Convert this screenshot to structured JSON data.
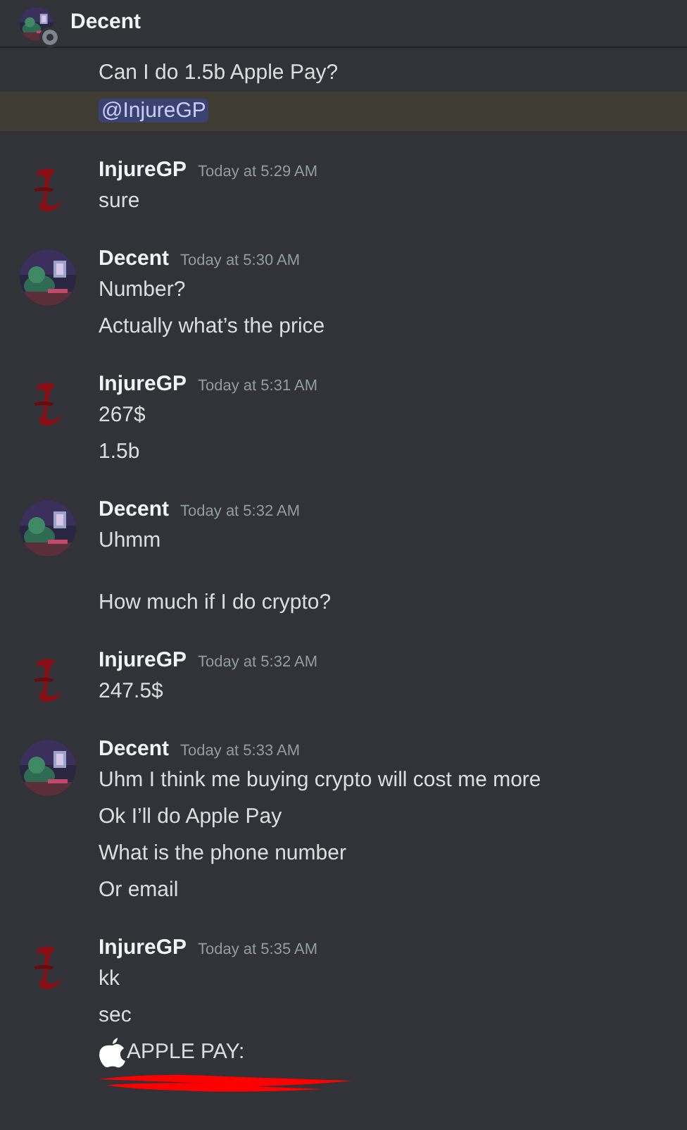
{
  "header": {
    "title": "Decent"
  },
  "groups": [
    {
      "continued": true,
      "messages": [
        {
          "kind": "text",
          "paragraphs": [
            "Can I do 1.5b Apple Pay?"
          ]
        },
        {
          "kind": "mention",
          "paragraphs": [
            "@InjureGP"
          ]
        }
      ]
    },
    {
      "author": "InjureGP",
      "time": "Today at 5:29 AM",
      "kind": "emblem",
      "messages": [
        {
          "kind": "text",
          "paragraphs": [
            "sure"
          ]
        }
      ]
    },
    {
      "author": "Decent",
      "time": "Today at 5:30 AM",
      "kind": "photo",
      "messages": [
        {
          "kind": "text",
          "paragraphs": [
            "Number?"
          ]
        },
        {
          "kind": "text",
          "paragraphs": [
            "Actually what’s the price"
          ]
        }
      ]
    },
    {
      "author": "InjureGP",
      "time": "Today at 5:31 AM",
      "kind": "emblem",
      "messages": [
        {
          "kind": "text",
          "paragraphs": [
            "267$"
          ]
        },
        {
          "kind": "text",
          "paragraphs": [
            "1.5b"
          ]
        }
      ]
    },
    {
      "author": "Decent",
      "time": "Today at 5:32 AM",
      "kind": "photo",
      "messages": [
        {
          "kind": "text",
          "paragraphs": [
            "Uhmm",
            "How much if I do crypto?"
          ]
        }
      ]
    },
    {
      "author": "InjureGP",
      "time": "Today at 5:32 AM",
      "kind": "emblem",
      "messages": [
        {
          "kind": "text",
          "paragraphs": [
            "247.5$"
          ]
        }
      ]
    },
    {
      "author": "Decent",
      "time": "Today at 5:33 AM",
      "kind": "photo",
      "messages": [
        {
          "kind": "text",
          "paragraphs": [
            "Uhm I think me buying crypto will cost me more"
          ]
        },
        {
          "kind": "text",
          "paragraphs": [
            "Ok I’ll do Apple Pay"
          ]
        },
        {
          "kind": "text",
          "paragraphs": [
            "What is the phone number"
          ]
        },
        {
          "kind": "text",
          "paragraphs": [
            "Or email"
          ]
        }
      ]
    },
    {
      "author": "InjureGP",
      "time": "Today at 5:35 AM",
      "kind": "emblem",
      "messages": [
        {
          "kind": "text",
          "paragraphs": [
            "kk"
          ]
        },
        {
          "kind": "text",
          "paragraphs": [
            "sec"
          ]
        },
        {
          "kind": "apple",
          "paragraphs": [
            "APPLE PAY:"
          ]
        },
        {
          "kind": "redacted"
        }
      ]
    }
  ]
}
